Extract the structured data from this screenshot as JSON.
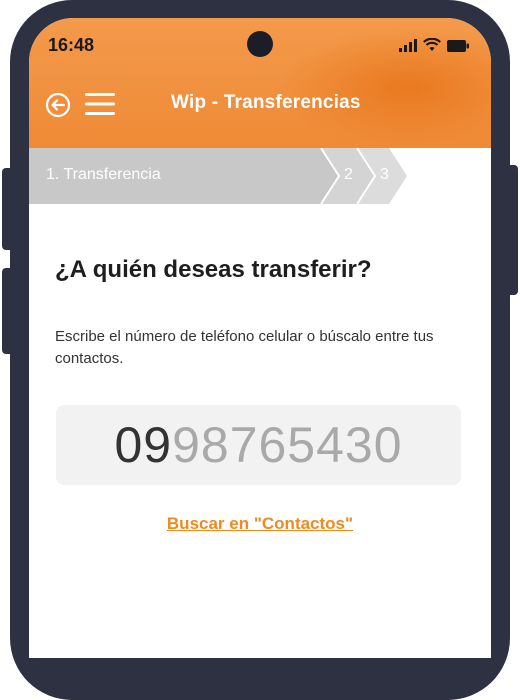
{
  "status_bar": {
    "time": "16:48"
  },
  "header": {
    "title": "Wip - Transferencias"
  },
  "steps": [
    {
      "label": "1. Transferencia",
      "active": true
    },
    {
      "label": "2",
      "active": false
    },
    {
      "label": "3",
      "active": false
    }
  ],
  "main": {
    "question": "¿A quién deseas transferir?",
    "description": "Escribe el número de teléfono celular o búscalo entre tus contactos.",
    "phone_typed": "09",
    "phone_rest": "98765430",
    "contacts_link": "Buscar en \"Contactos\""
  },
  "colors": {
    "accent": "#ef8a36",
    "link": "#ef8a1e",
    "step_bar": "#c8c8c8",
    "frame": "#2d3142"
  }
}
